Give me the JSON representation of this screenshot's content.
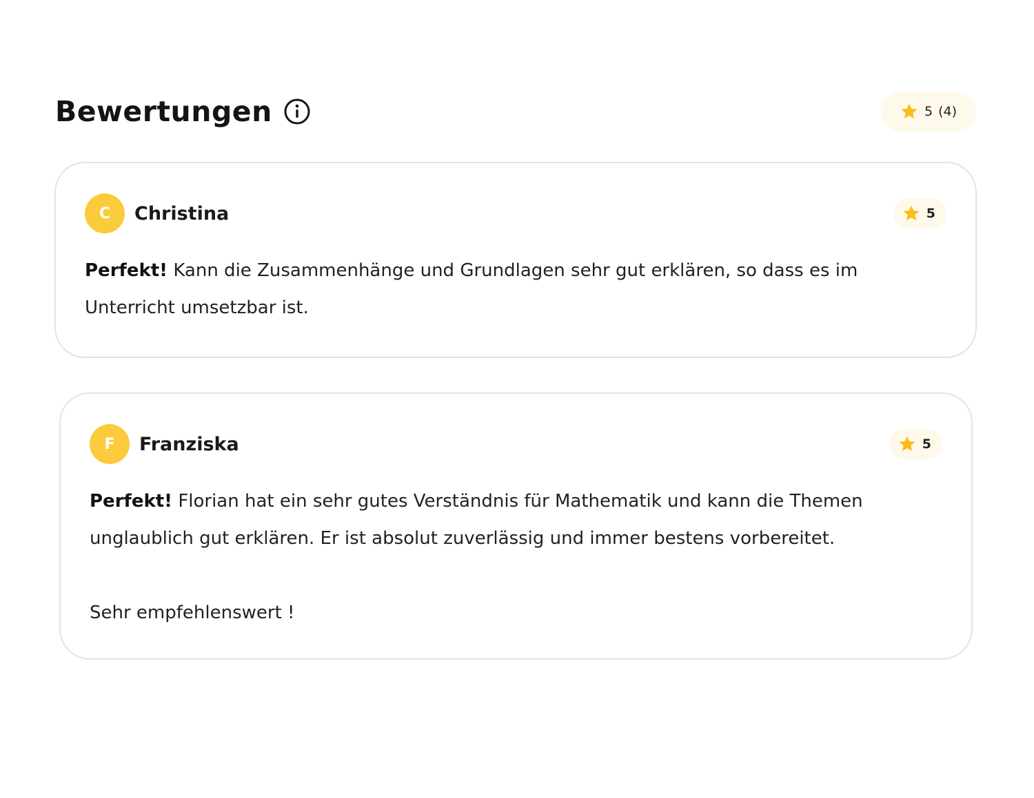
{
  "header": {
    "title": "Bewertungen",
    "summary_rating": "5",
    "summary_count": "(4)"
  },
  "colors": {
    "star": "#fbbd1a",
    "avatar": "#fccb3b",
    "pill_bg": "#fff9ec",
    "card_border": "#e4e4e4"
  },
  "reviews": [
    {
      "initial": "C",
      "name": "Christina",
      "rating": "5",
      "headline": "Perfekt!",
      "text": "Kann die Zusammenhänge und Grundlagen sehr gut erklären, so dass es im Unterricht umsetzbar ist.",
      "extra": ""
    },
    {
      "initial": "F",
      "name": "Franziska",
      "rating": "5",
      "headline": "Perfekt!",
      "text": "Florian hat ein sehr gutes Verständnis für Mathematik und kann die Themen unglaublich gut erklären. Er ist absolut zuverlässig und immer bestens vorbereitet.",
      "extra": "Sehr empfehlenswert !"
    }
  ]
}
